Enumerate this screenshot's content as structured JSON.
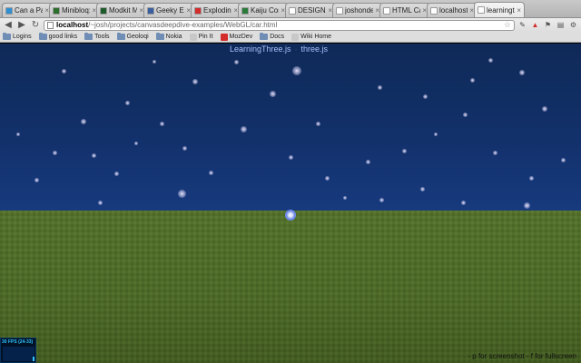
{
  "browser": {
    "tabs": [
      {
        "title": "Can a Parki",
        "favicon_color": "#2f8fd1",
        "active": false
      },
      {
        "title": "Minibloq: g",
        "favicon_color": "#2c6e2c",
        "active": false
      },
      {
        "title": "Modkit Micr",
        "favicon_color": "#1d5c2a",
        "active": false
      },
      {
        "title": "Geeky End",
        "favicon_color": "#3a5fa0",
        "active": false
      },
      {
        "title": "Exploding",
        "favicon_color": "#d42b2b",
        "active": false
      },
      {
        "title": "Kaiju Comb",
        "favicon_color": "#2a7a3a",
        "active": false
      },
      {
        "title": "DESIGNER",
        "favicon_color": "#ffffff",
        "active": false
      },
      {
        "title": "joshondesi",
        "favicon_color": "#ffffff",
        "active": false
      },
      {
        "title": "HTML Canv",
        "favicon_color": "#ffffff",
        "active": false
      },
      {
        "title": "localhost/",
        "favicon_color": "#ffffff",
        "active": false
      },
      {
        "title": "learningthr",
        "favicon_color": "#ffffff",
        "active": true
      }
    ],
    "tab_close_glyph": "×",
    "nav": {
      "back": "◀",
      "forward": "▶",
      "reload": "↻"
    },
    "address": {
      "host": "localhost",
      "path": "/~josh/projects/canvasdeepdive-examples/WebGL/car.html"
    },
    "bookmarks": [
      {
        "label": "Logins",
        "type": "folder"
      },
      {
        "label": "good links",
        "type": "folder"
      },
      {
        "label": "Tools",
        "type": "folder"
      },
      {
        "label": "Geoloqi",
        "type": "folder"
      },
      {
        "label": "Nokia",
        "type": "folder"
      },
      {
        "label": "Pin It",
        "type": "page",
        "color": "#c8c8c8"
      },
      {
        "label": "MozDev",
        "type": "page",
        "color": "#d42b2b"
      },
      {
        "label": "Docs",
        "type": "folder"
      },
      {
        "label": "Wiki Home",
        "type": "page",
        "color": "#c8c8c8"
      }
    ]
  },
  "scene": {
    "title_left": "LearningThree.js",
    "title_sep": "·",
    "title_right": "three.js",
    "fps_label": "30 FPS (24-33)",
    "fps_level": 0.3,
    "hint": "- p for screenshot - f for fullscreen",
    "colors": {
      "sky": "#12306a",
      "ground": "#4f6c28",
      "accent": "#8aa6ff"
    }
  }
}
